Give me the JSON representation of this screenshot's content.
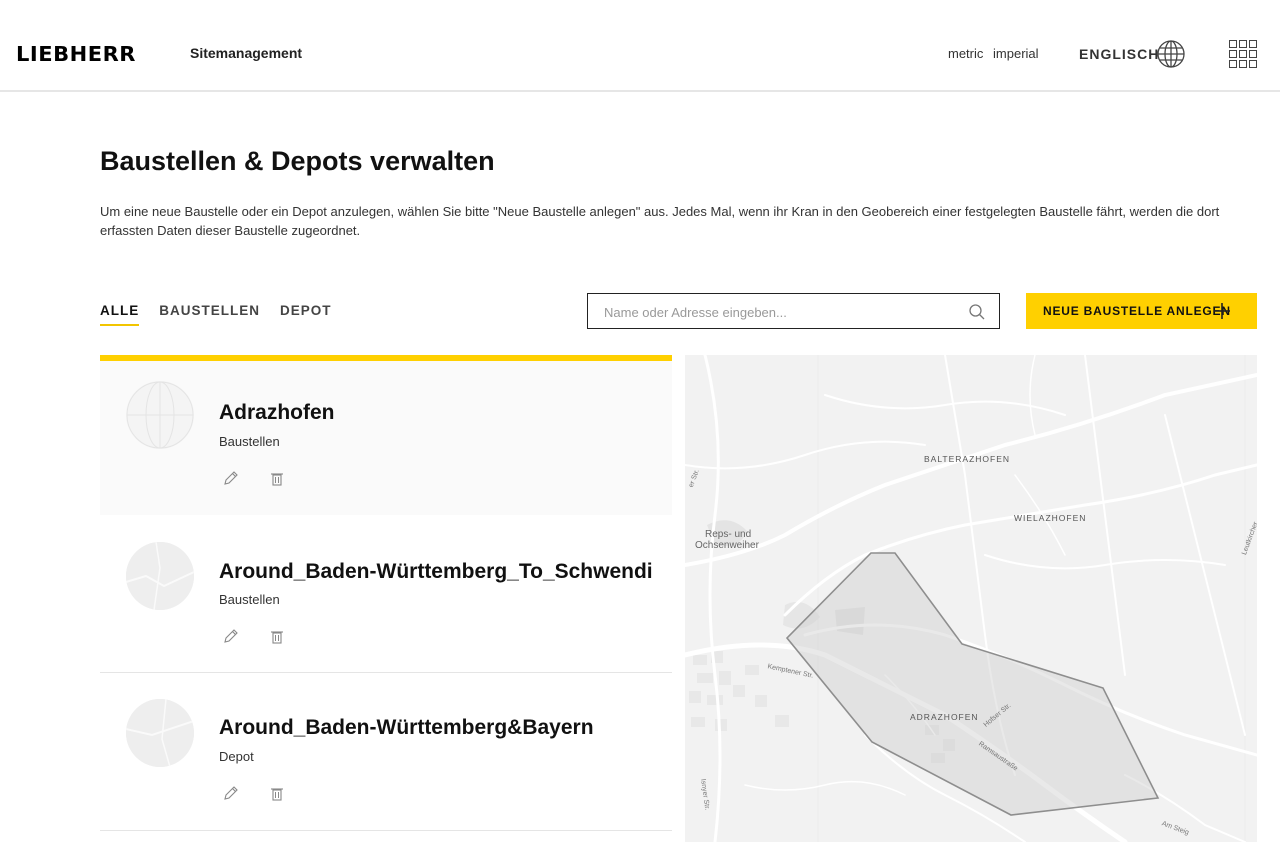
{
  "header": {
    "logo": "LIEBHERR",
    "app_name": "Sitemanagement",
    "unit_metric": "metric",
    "unit_imperial": "imperial",
    "language": "ENGLISCH"
  },
  "page": {
    "title": "Baustellen & Depots verwalten",
    "description": "Um eine neue Baustelle oder ein Depot anzulegen, wählen Sie bitte \"Neue Baustelle anlegen\" aus. Jedes Mal, wenn ihr Kran in den Geobereich einer festgelegten Baustelle fährt, werden die dort erfassten Daten dieser Baustelle zugeordnet."
  },
  "filters": {
    "tabs": [
      {
        "label": "ALLE",
        "active": true
      },
      {
        "label": "BAUSTELLEN",
        "active": false
      },
      {
        "label": "DEPOT",
        "active": false
      }
    ]
  },
  "search": {
    "placeholder": "Name oder Adresse eingeben...",
    "value": ""
  },
  "new_button": {
    "label": "NEUE BAUSTELLE ANLEGEN"
  },
  "sites": [
    {
      "name": "Adrazhofen",
      "type": "Baustellen",
      "selected": true
    },
    {
      "name": "Around_Baden-Württemberg_To_Schwendi",
      "type": "Baustellen",
      "selected": false
    },
    {
      "name": "Around_Baden-Württemberg&Bayern",
      "type": "Depot",
      "selected": false
    }
  ],
  "map": {
    "labels": {
      "balterazhofen": "BALTERAZHOFEN",
      "wielazhofen": "WIELAZHOFEN",
      "adrazhofen": "ADRAZHOFEN",
      "reps_line1": "Reps- und",
      "reps_line2": "Ochsenweiher"
    },
    "streets": {
      "kemptener": "Kemptener Str.",
      "hofser": "Hofser Str.",
      "ramsauer": "Ramsaustraße",
      "isnyer": "Isnyer Str.",
      "am_steig": "Am Steig",
      "leutkircher": "Leutkircher",
      "edge_top": "er Str."
    },
    "colors": {
      "background": "#f2f2f2",
      "road": "#ffffff",
      "polygon_fill": "#cfcfcf",
      "polygon_stroke": "#8e8e8e"
    }
  },
  "colors": {
    "accent": "#ffd000",
    "text": "#111111"
  }
}
